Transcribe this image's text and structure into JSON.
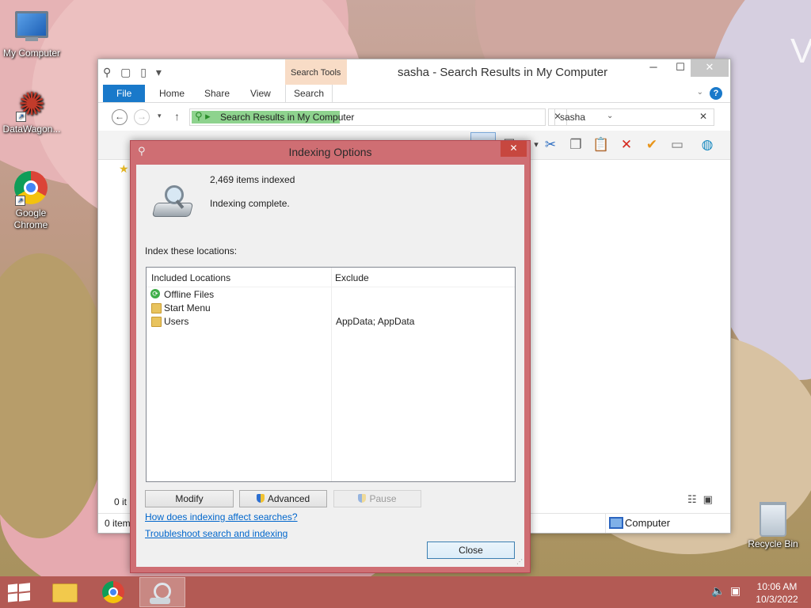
{
  "desktop": {
    "icons": [
      {
        "label": "My Computer"
      },
      {
        "label": "DataWagon..."
      },
      {
        "label": "Google Chrome"
      },
      {
        "label": "Recycle Bin"
      }
    ]
  },
  "explorer": {
    "title": "sasha - Search Results in My Computer",
    "contextual_tab": "Search Tools",
    "tabs": {
      "file": "File",
      "home": "Home",
      "share": "Share",
      "view": "View",
      "search": "Search"
    },
    "address": "Search Results in My Computer",
    "search_value": "sasha",
    "status_items": "0 items",
    "status_items_partial": "0 it",
    "status_location": "Computer"
  },
  "dialog": {
    "title": "Indexing Options",
    "items_indexed": "2,469 items indexed",
    "status": "Indexing complete.",
    "locations_label": "Index these locations:",
    "columns": {
      "included": "Included Locations",
      "exclude": "Exclude"
    },
    "rows": [
      {
        "name": "Offline Files",
        "exclude": "",
        "icon": "sync-icon"
      },
      {
        "name": "Start Menu",
        "exclude": "",
        "icon": "folder-icon"
      },
      {
        "name": "Users",
        "exclude": "AppData; AppData",
        "icon": "folder-icon"
      }
    ],
    "buttons": {
      "modify": "Modify",
      "advanced": "Advanced",
      "pause": "Pause",
      "close": "Close"
    },
    "links": {
      "how": "How does indexing affect searches?",
      "troubleshoot": "Troubleshoot search and indexing"
    }
  },
  "taskbar": {
    "time": "10:06 AM",
    "date": "10/3/2022"
  },
  "colors": {
    "dialog_frame": "#cf6e73",
    "taskbar": "#b35a54",
    "ribbon_file": "#1979ca",
    "address_highlight": "#8ed38e",
    "link": "#0066cc"
  }
}
